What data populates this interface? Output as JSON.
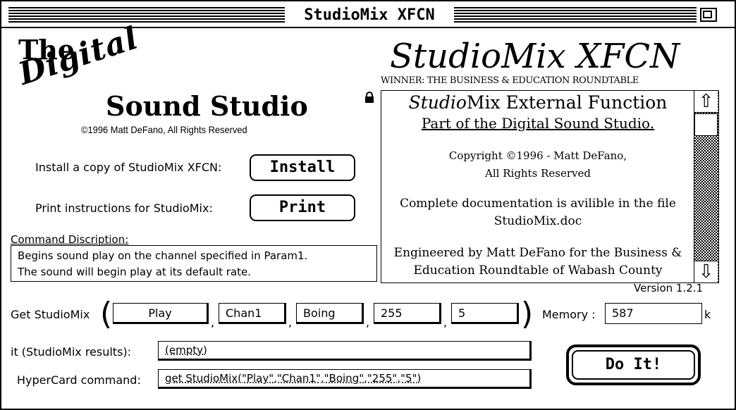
{
  "window": {
    "title": "StudioMix XFCN"
  },
  "header_left": {
    "the": "The",
    "digital": "Digital",
    "sound_studio": "Sound Studio",
    "copyright": "©1996 Matt DeFano, All Rights Reserved"
  },
  "header_right": {
    "title": "StudioMix XFCN",
    "winner": "WINNER: THE BUSINESS & EDUCATION ROUNDTABLE"
  },
  "install": {
    "label": "Install a copy of StudioMix XFCN:",
    "button": "Install"
  },
  "print": {
    "label": "Print instructions for StudioMix:",
    "button": "Print"
  },
  "command_description": {
    "label": "Command Discription:",
    "lines": [
      "Begins sound play on the channel specified in Param1.",
      "The sound will begin play at its default rate."
    ]
  },
  "info": {
    "heading_italic": "Studio",
    "heading_rest": "Mix External Function",
    "subheading": "Part of the Digital Sound Studio.",
    "copyright_lines": [
      "Copyright ©1996 - Matt DeFano,",
      "All Rights Reserved"
    ],
    "doc_lines": [
      "Complete documentation is avilible in the file",
      "StudioMix.doc"
    ],
    "engineered_lines": [
      "Engineered by Matt DeFano for the Business &",
      "Education Roundtable of Wabash County"
    ],
    "scroll_up": "⇧",
    "scroll_down": "⇩"
  },
  "version": "Version 1.2.1",
  "get_studiomix": {
    "label": "Get StudioMix",
    "params": [
      "Play",
      "Chan1",
      "Boing",
      "255",
      "5"
    ],
    "open_paren": "(",
    "close_paren": ")",
    "comma": ","
  },
  "memory": {
    "label": "Memory :",
    "value": "587",
    "unit": "k"
  },
  "results": {
    "label": "it (StudioMix results):",
    "value": "(empty)"
  },
  "hypercard": {
    "label": "HyperCard command:",
    "value": "get StudioMix(\"Play\",\"Chan1\",\"Boing\",\"255\",\"5\")"
  },
  "do_it": {
    "button": "Do It!"
  }
}
